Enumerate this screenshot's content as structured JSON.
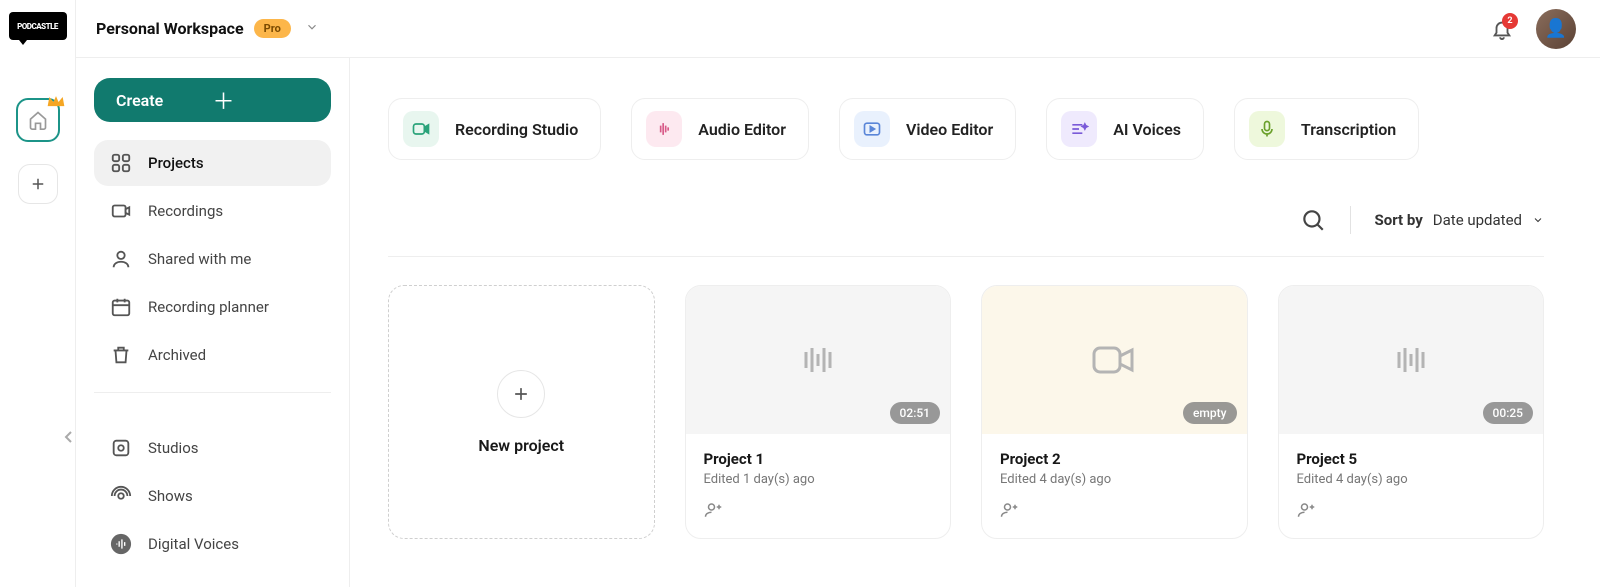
{
  "header": {
    "workspace_name": "Personal Workspace",
    "badge": "Pro",
    "notification_count": "2"
  },
  "sidebar": {
    "create_label": "Create",
    "nav1": [
      {
        "label": "Projects"
      },
      {
        "label": "Recordings"
      },
      {
        "label": "Shared with me"
      },
      {
        "label": "Recording planner"
      },
      {
        "label": "Archived"
      }
    ],
    "nav2": [
      {
        "label": "Studios"
      },
      {
        "label": "Shows"
      },
      {
        "label": "Digital Voices"
      }
    ]
  },
  "quick": [
    {
      "label": "Recording Studio",
      "bg": "#e8f6ef",
      "fg": "#2aa37a"
    },
    {
      "label": "Audio Editor",
      "bg": "#fde9f0",
      "fg": "#d85a88"
    },
    {
      "label": "Video Editor",
      "bg": "#e9f1fd",
      "fg": "#5a86d8"
    },
    {
      "label": "AI Voices",
      "bg": "#efeafd",
      "fg": "#7a5ad8"
    },
    {
      "label": "Transcription",
      "bg": "#eef8dc",
      "fg": "#6aa02b"
    }
  ],
  "list": {
    "sort_label": "Sort by",
    "sort_value": "Date updated"
  },
  "new_project_label": "New project",
  "projects": [
    {
      "title": "Project 1",
      "subtitle": "Edited 1 day(s) ago",
      "duration": "02:51",
      "type": "audio"
    },
    {
      "title": "Project 2",
      "subtitle": "Edited 4 day(s) ago",
      "duration": "empty",
      "type": "video"
    },
    {
      "title": "Project 5",
      "subtitle": "Edited 4 day(s) ago",
      "duration": "00:25",
      "type": "audio"
    }
  ]
}
